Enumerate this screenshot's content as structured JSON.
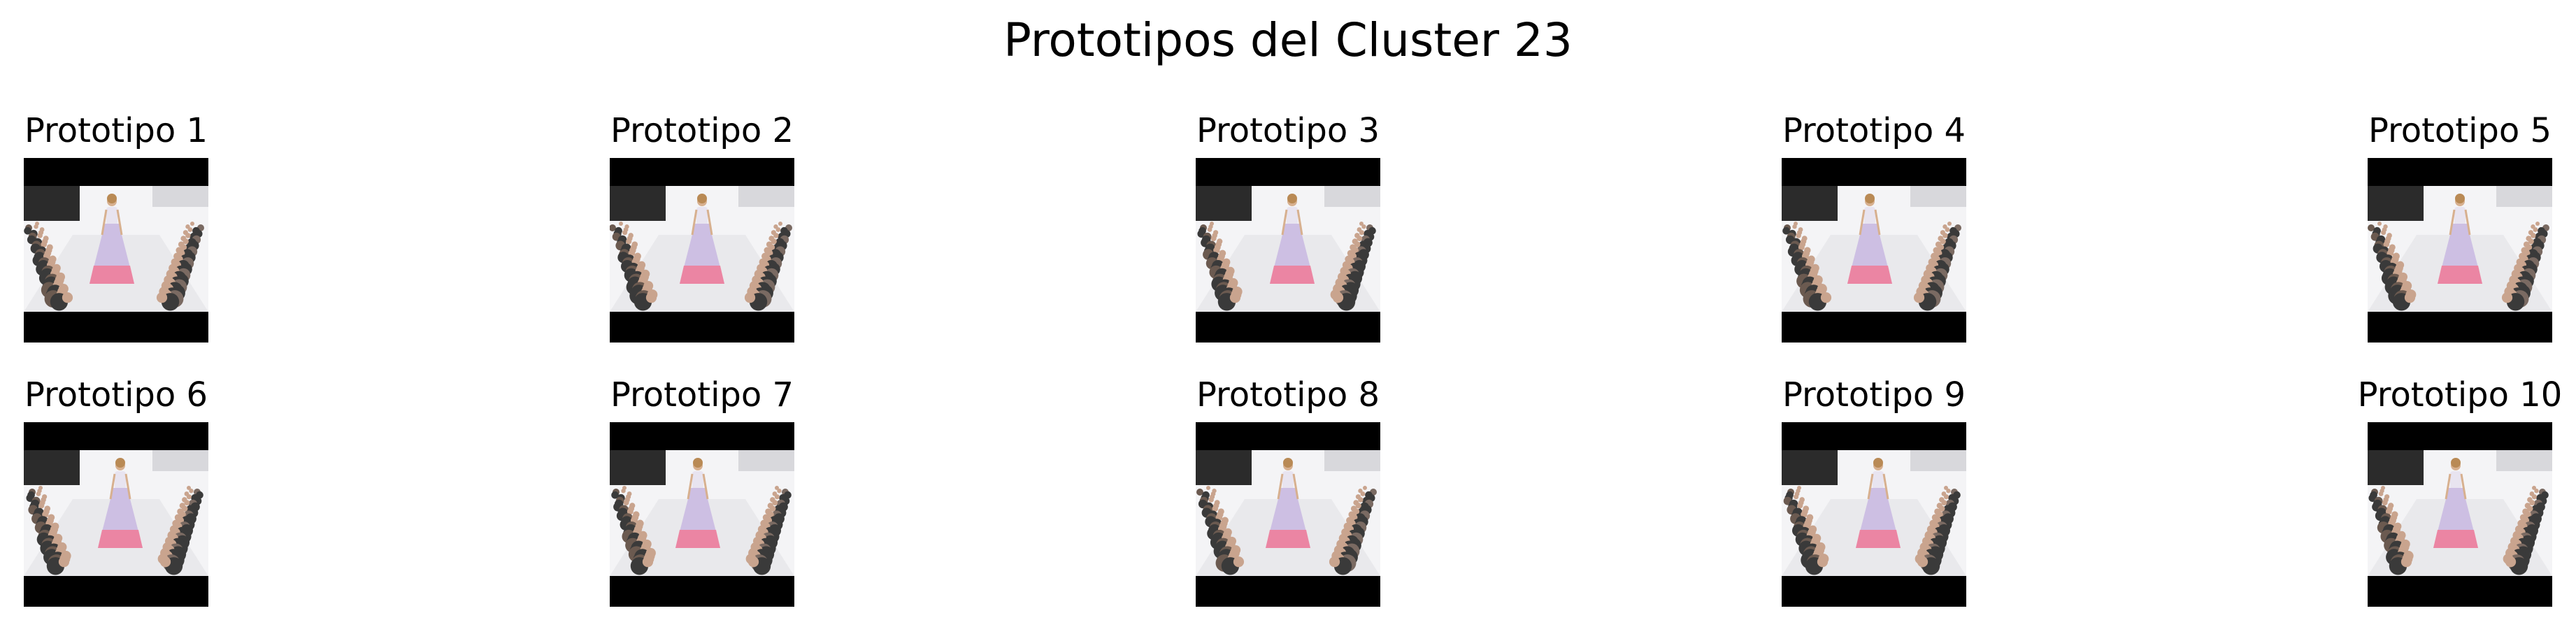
{
  "figure": {
    "suptitle": "Prototipos del Cluster 23"
  },
  "prototypes": [
    {
      "title": "Prototipo 1",
      "subject": "runway-model-image"
    },
    {
      "title": "Prototipo 2",
      "subject": "runway-model-image"
    },
    {
      "title": "Prototipo 3",
      "subject": "runway-model-image"
    },
    {
      "title": "Prototipo 4",
      "subject": "runway-model-image"
    },
    {
      "title": "Prototipo 5",
      "subject": "runway-model-image"
    },
    {
      "title": "Prototipo 6",
      "subject": "runway-model-image"
    },
    {
      "title": "Prototipo 7",
      "subject": "runway-model-image"
    },
    {
      "title": "Prototipo 8",
      "subject": "runway-model-image"
    },
    {
      "title": "Prototipo 9",
      "subject": "runway-model-image"
    },
    {
      "title": "Prototipo 10",
      "subject": "runway-model-image"
    }
  ],
  "colors": {
    "background": "#ffffff",
    "letterbox": "#000000",
    "runway_floor": "#e9e9ec",
    "backdrop": "#f4f4f6",
    "dress": "#cdbfe3",
    "dress_hem": "#f07a98",
    "audience_dark": "#3a3a3a"
  }
}
